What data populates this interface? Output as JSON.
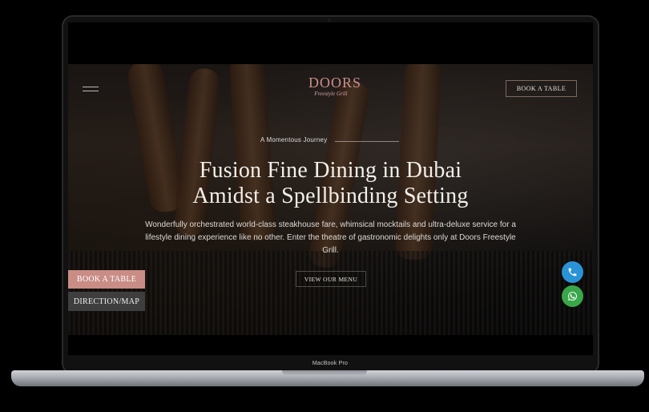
{
  "site": {
    "logo_main": "DOORS",
    "logo_sub": "Freestyle Grill",
    "top_cta": "BOOK A TABLE",
    "eyebrow": "A Momentous Journey",
    "headline_line1": "Fusion Fine Dining in Dubai",
    "headline_line2": "Amidst a Spellbinding Setting",
    "description": "Wonderfully orchestrated world-class steakhouse fare, whimsical mocktails and ultra-deluxe service for a lifestyle dining experience like no other. Enter the theatre of gastronomic delights only at Doors Freestyle Grill.",
    "menu_cta": "VIEW OUR MENU",
    "side_buttons": {
      "book": "BOOK A TABLE",
      "directions": "DIRECTION/MAP"
    },
    "icons": {
      "menu": "hamburger-menu-icon",
      "phone": "phone-icon",
      "whatsapp": "whatsapp-icon"
    },
    "colors": {
      "brand_accent": "#c98d86",
      "phone_fab": "#2a93d6",
      "whatsapp_fab": "#3aa64a"
    }
  },
  "device": {
    "label": "MacBook Pro"
  }
}
